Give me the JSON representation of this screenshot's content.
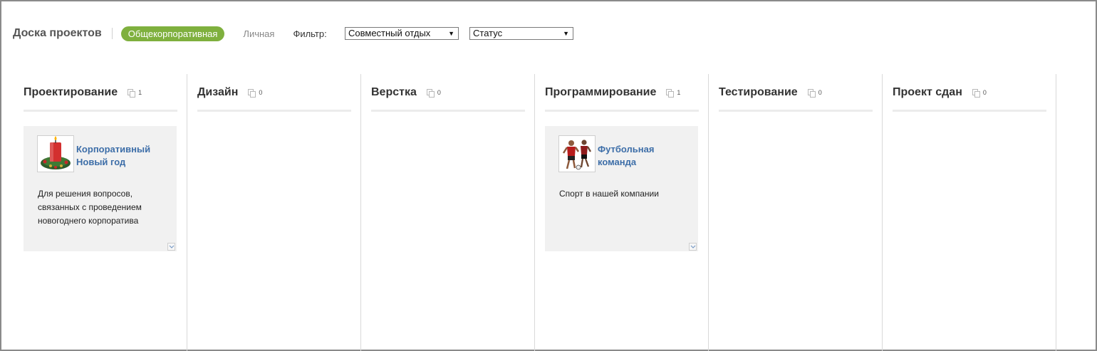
{
  "header": {
    "board_title": "Доска проектов",
    "tab_corporate": "Общекорпоративная",
    "tab_personal": "Личная",
    "filter_label": "Фильтр:",
    "filter_select_value": "Совместный отдых",
    "status_select_value": "Статус"
  },
  "colors": {
    "accent_green": "#7fb03e",
    "link_blue": "#3d6ea8",
    "card_bg": "#f1f1f1"
  },
  "columns": [
    {
      "title": "Проектирование",
      "count": "1"
    },
    {
      "title": "Дизайн",
      "count": "0"
    },
    {
      "title": "Верстка",
      "count": "0"
    },
    {
      "title": "Программирование",
      "count": "1"
    },
    {
      "title": "Тестирование",
      "count": "0"
    },
    {
      "title": "Проект сдан",
      "count": "0"
    }
  ],
  "cards": [
    {
      "column": "Проектирование",
      "title_line1": "Корпоративный",
      "title_line2": "Новый год",
      "desc_line1": "Для решения вопросов,",
      "desc_line2": "связанных с проведением",
      "desc_line3": "новогоднего корпоратива",
      "image": "christmas-candle-wreath"
    },
    {
      "column": "Программирование",
      "title_line1": "Футбольная",
      "title_line2": "команда",
      "desc_line1": "Спорт в нашей компании",
      "image": "football-players"
    }
  ],
  "icons": {
    "count_icon": "documents-icon",
    "expand_icon": "chevron-down-icon",
    "select_arrow": "triangle-down-icon"
  }
}
